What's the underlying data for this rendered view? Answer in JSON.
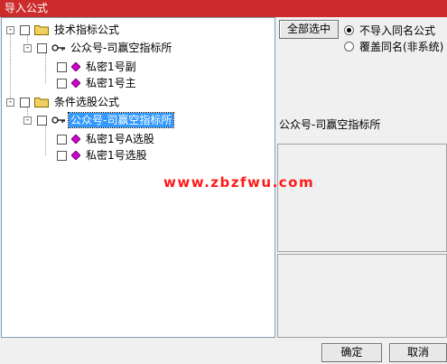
{
  "window": {
    "title": "导入公式"
  },
  "tree": {
    "groups": [
      {
        "label": "技术指标公式",
        "sub": {
          "label": "公众号-司赢空指标所",
          "items": [
            "私密1号副",
            "私密1号主"
          ]
        }
      },
      {
        "label": "条件选股公式",
        "sub": {
          "label": "公众号-司赢空指标所",
          "items": [
            "私密1号A选股",
            "私密1号选股"
          ]
        }
      }
    ],
    "expander_symbol": "-"
  },
  "options": {
    "select_all_label": "全部选中",
    "radio_no_import": "不导入同名公式",
    "radio_overwrite": "覆盖同名(非系统)",
    "selected_radio": "no_import"
  },
  "details": {
    "name": "公众号-司赢空指标所"
  },
  "watermark": "www.zbzfwu.com",
  "buttons": {
    "ok": "确定",
    "cancel": "取消"
  },
  "icons": {
    "folder": "folder-icon",
    "key": "key-icon",
    "formula": "gem-icon"
  },
  "colors": {
    "titlebar": "#cc2b2b",
    "selection": "#3399ff",
    "watermark": "#ff1a1a",
    "gem": "#cc00cc",
    "folder": "#f0d060"
  }
}
